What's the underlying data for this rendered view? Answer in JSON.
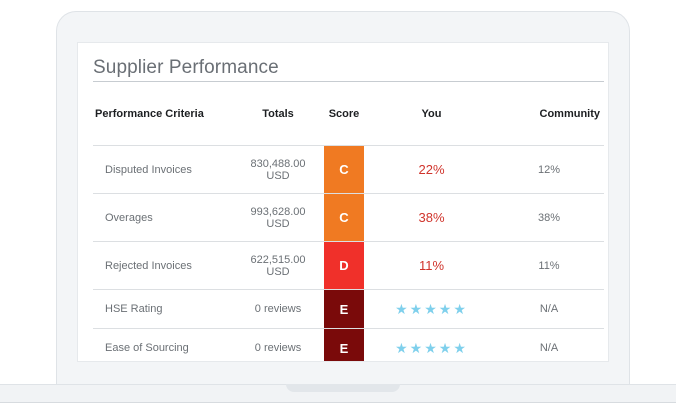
{
  "panel": {
    "title": "Supplier Performance"
  },
  "table": {
    "headers": {
      "criteria": "Performance Criteria",
      "totals": "Totals",
      "score": "Score",
      "you": "You",
      "community": "Community"
    },
    "rows": [
      {
        "criteria": "Disputed Invoices",
        "totals_amount": "830,488.00",
        "totals_unit": "USD",
        "grade": "C",
        "grade_color": "#f07a22",
        "you": "22%",
        "community": "12%"
      },
      {
        "criteria": "Overages",
        "totals_amount": "993,628.00",
        "totals_unit": "USD",
        "grade": "C",
        "grade_color": "#f07a22",
        "you": "38%",
        "community": "38%"
      },
      {
        "criteria": "Rejected Invoices",
        "totals_amount": "622,515.00",
        "totals_unit": "USD",
        "grade": "D",
        "grade_color": "#f0302a",
        "you": "11%",
        "community": "11%"
      },
      {
        "criteria": "HSE Rating",
        "totals_amount": "0 reviews",
        "grade": "E",
        "grade_color": "#7a0a0a",
        "you_stars": "★★★★★",
        "community": "N/A"
      },
      {
        "criteria": "Ease of Sourcing",
        "totals_amount": "0 reviews",
        "grade": "E",
        "grade_color": "#7a0a0a",
        "you_stars": "★★★★★",
        "community": "N/A"
      }
    ]
  },
  "colors": {
    "you_percent": "#d0342c",
    "stars": "#7fd0ec"
  }
}
